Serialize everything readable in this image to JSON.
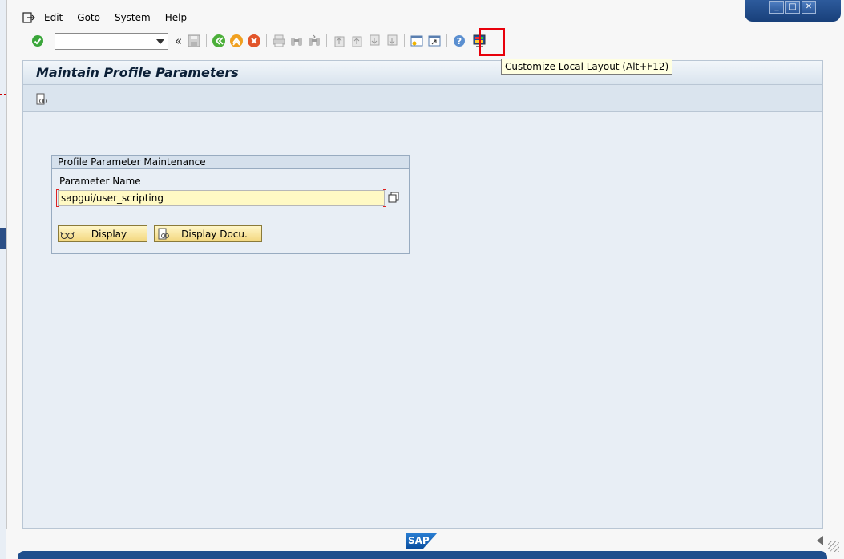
{
  "menu": {
    "items": [
      {
        "label": "Edit",
        "accel": "E",
        "rest": "dit"
      },
      {
        "label": "Goto",
        "accel": "G",
        "rest": "oto"
      },
      {
        "label": "System",
        "accel": "S",
        "rest": "ystem"
      },
      {
        "label": "Help",
        "accel": "H",
        "rest": "elp"
      }
    ]
  },
  "toolbar": {
    "command_value": "",
    "tooltip": "Customize Local Layout (Alt+F12)"
  },
  "screen": {
    "title": "Maintain Profile Parameters"
  },
  "group": {
    "title": "Profile Parameter Maintenance",
    "param_label": "Parameter Name",
    "param_value": "sapgui/user_scripting",
    "display_label": "Display",
    "display_docu_label": "Display Docu."
  },
  "status": {
    "logo_text": "SAP"
  },
  "colors": {
    "highlight": "#e8000b",
    "input_required": "#fff9c4",
    "frame_bg": "#e8eef5"
  }
}
